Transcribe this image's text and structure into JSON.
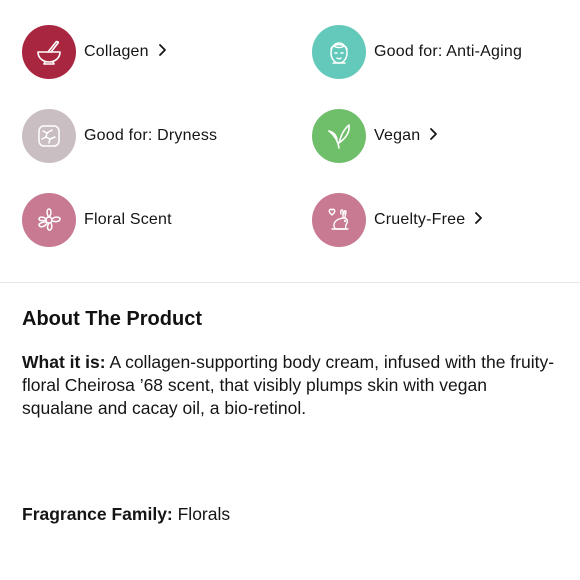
{
  "attributes": [
    {
      "label": "Collagen",
      "has_chevron": true,
      "icon": "mortar-pestle-icon",
      "color": "#a8263f"
    },
    {
      "label": "Good for: Anti-Aging",
      "has_chevron": false,
      "icon": "face-mask-icon",
      "color": "#62c9bb"
    },
    {
      "label": "Good for: Dryness",
      "has_chevron": false,
      "icon": "dry-skin-icon",
      "color": "#c9bfc2"
    },
    {
      "label": "Vegan",
      "has_chevron": true,
      "icon": "leaf-icon",
      "color": "#6fbe6a"
    },
    {
      "label": "Floral Scent",
      "has_chevron": false,
      "icon": "flower-icon",
      "color": "#c77a92"
    },
    {
      "label": "Cruelty-Free",
      "has_chevron": true,
      "icon": "bunny-heart-icon",
      "color": "#c77a92"
    }
  ],
  "about": {
    "title": "About The Product",
    "what_it_is_label": "What it is:",
    "what_it_is_text": " A collagen-supporting body cream, infused with the fruity-floral Cheirosa ’68 scent, that visibly plumps skin with vegan squalane and cacay oil, a bio-retinol.",
    "fragrance_label": "Fragrance Family:",
    "fragrance_value": " Florals"
  }
}
